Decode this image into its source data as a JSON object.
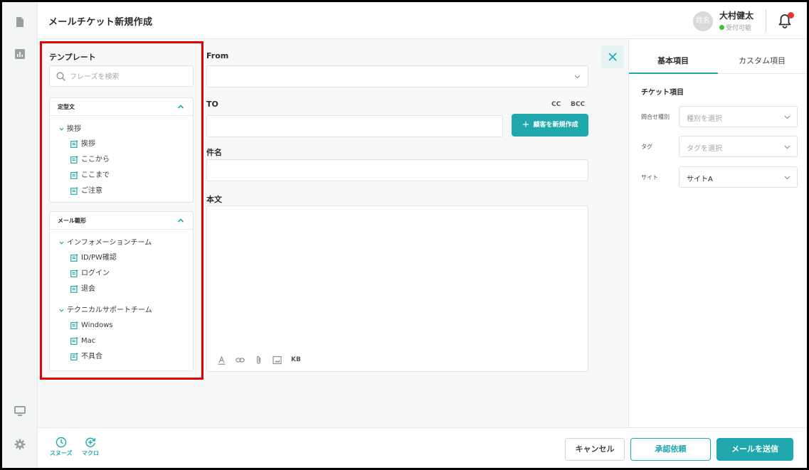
{
  "header": {
    "title": "メールチケット新規作成",
    "avatar_text": "姓名",
    "user_name": "大村健太",
    "user_status": "受付可能"
  },
  "templates": {
    "title": "テンプレート",
    "search_placeholder": "フレーズを検索",
    "sections": [
      {
        "label": "定型文",
        "folders": [
          {
            "name": "挨拶",
            "items": [
              "挨拶",
              "ここから",
              "ここまで",
              "ご注意"
            ]
          }
        ]
      },
      {
        "label": "メール雛形",
        "folders": [
          {
            "name": "インフォメーションチーム",
            "items": [
              "ID/PW確認",
              "ログイン",
              "退会"
            ]
          },
          {
            "name": "テクニカルサポートチーム",
            "items": [
              "Windows",
              "Mac",
              "不具合"
            ]
          }
        ]
      }
    ]
  },
  "compose": {
    "from_label": "From",
    "to_label": "TO",
    "cc_label": "CC",
    "bcc_label": "BCC",
    "new_customer_label": "顧客を新規作成",
    "subject_label": "件名",
    "body_label": "本文",
    "toolbar_kb": "KB"
  },
  "right_panel": {
    "tabs": [
      "基本項目",
      "カスタム項目"
    ],
    "section_title": "チケット項目",
    "rows": [
      {
        "label": "問合せ種別",
        "placeholder": "種別を選択",
        "value": ""
      },
      {
        "label": "タグ",
        "placeholder": "タグを選択",
        "value": ""
      },
      {
        "label": "サイト",
        "placeholder": "",
        "value": "サイトA"
      }
    ]
  },
  "footer": {
    "snooze_label": "スヌーズ",
    "macro_label": "マクロ",
    "cancel_label": "キャンセル",
    "approve_label": "承認依頼",
    "send_label": "メールを送信"
  },
  "colors": {
    "accent": "#20a8ad",
    "highlight": "#e30000",
    "status_online": "#3cc13b",
    "badge": "#e53935"
  }
}
